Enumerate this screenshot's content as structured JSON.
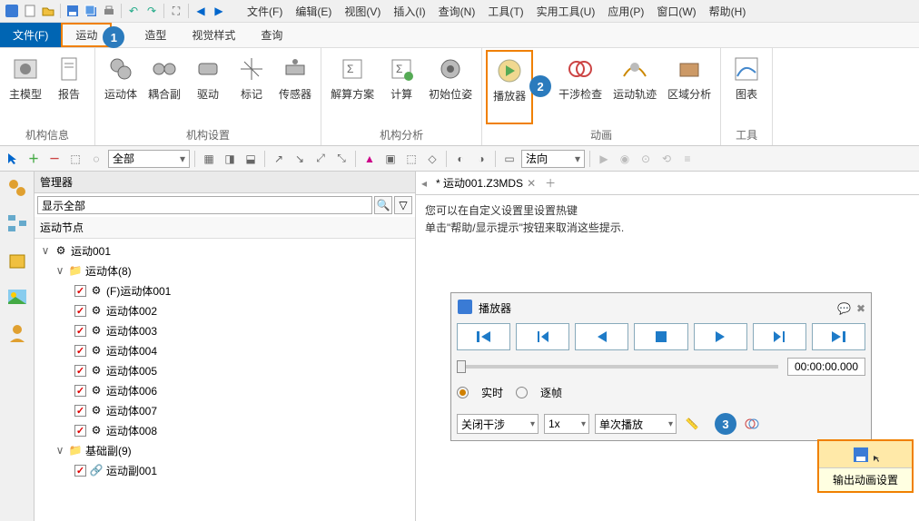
{
  "menu": {
    "file": "文件(F)",
    "edit": "编辑(E)",
    "view": "视图(V)",
    "insert": "插入(I)",
    "query": "查询(N)",
    "tools": "工具(T)",
    "util": "实用工具(U)",
    "app": "应用(P)",
    "window": "窗口(W)",
    "help": "帮助(H)"
  },
  "tabs": {
    "file": "文件(F)",
    "motion": "运动",
    "shape": "造型",
    "visual": "视觉样式",
    "query": "查询"
  },
  "ribbon": {
    "g1": {
      "label": "机构信息",
      "mainmodel": "主模型",
      "report": "报告"
    },
    "g2": {
      "label": "机构设置",
      "body": "运动体",
      "joint": "耦合副",
      "drive": "驱动",
      "marker": "标记",
      "sensor": "传感器"
    },
    "g3": {
      "label": "机构分析",
      "solver": "解算方案",
      "calc": "计算",
      "initpos": "初始位姿"
    },
    "g4": {
      "label": "动画",
      "player": "播放器",
      "interf": "干涉检查",
      "trace": "运动轨迹",
      "zone": "区域分析"
    },
    "g5": {
      "label": "工具",
      "chart": "图表"
    }
  },
  "toolbar": {
    "filter": "全部",
    "orient": "法向"
  },
  "manager": {
    "title": "管理器",
    "showall": "显示全部",
    "treelbl": "运动节点"
  },
  "tree": {
    "root": "运动001",
    "bodies": "运动体(8)",
    "b": [
      "(F)运动体001",
      "运动体002",
      "运动体003",
      "运动体004",
      "运动体005",
      "运动体006",
      "运动体007",
      "运动体008"
    ],
    "joints": "基础副(9)",
    "j1": "运动副001"
  },
  "doc": {
    "name": "* 运动001.Z3MDS"
  },
  "hint": {
    "l1": "您可以在自定义设置里设置热键",
    "l2": "单击\"帮助/显示提示\"按钮来取消这些提示."
  },
  "player": {
    "title": "播放器",
    "time": "00:00:00.000",
    "rt": "实时",
    "frame": "逐帧",
    "interf": "关闭干涉",
    "speed": "1x",
    "loop": "单次播放"
  },
  "export": {
    "label": "输出动画设置"
  },
  "badges": {
    "b1": "1",
    "b2": "2",
    "b3": "3"
  }
}
